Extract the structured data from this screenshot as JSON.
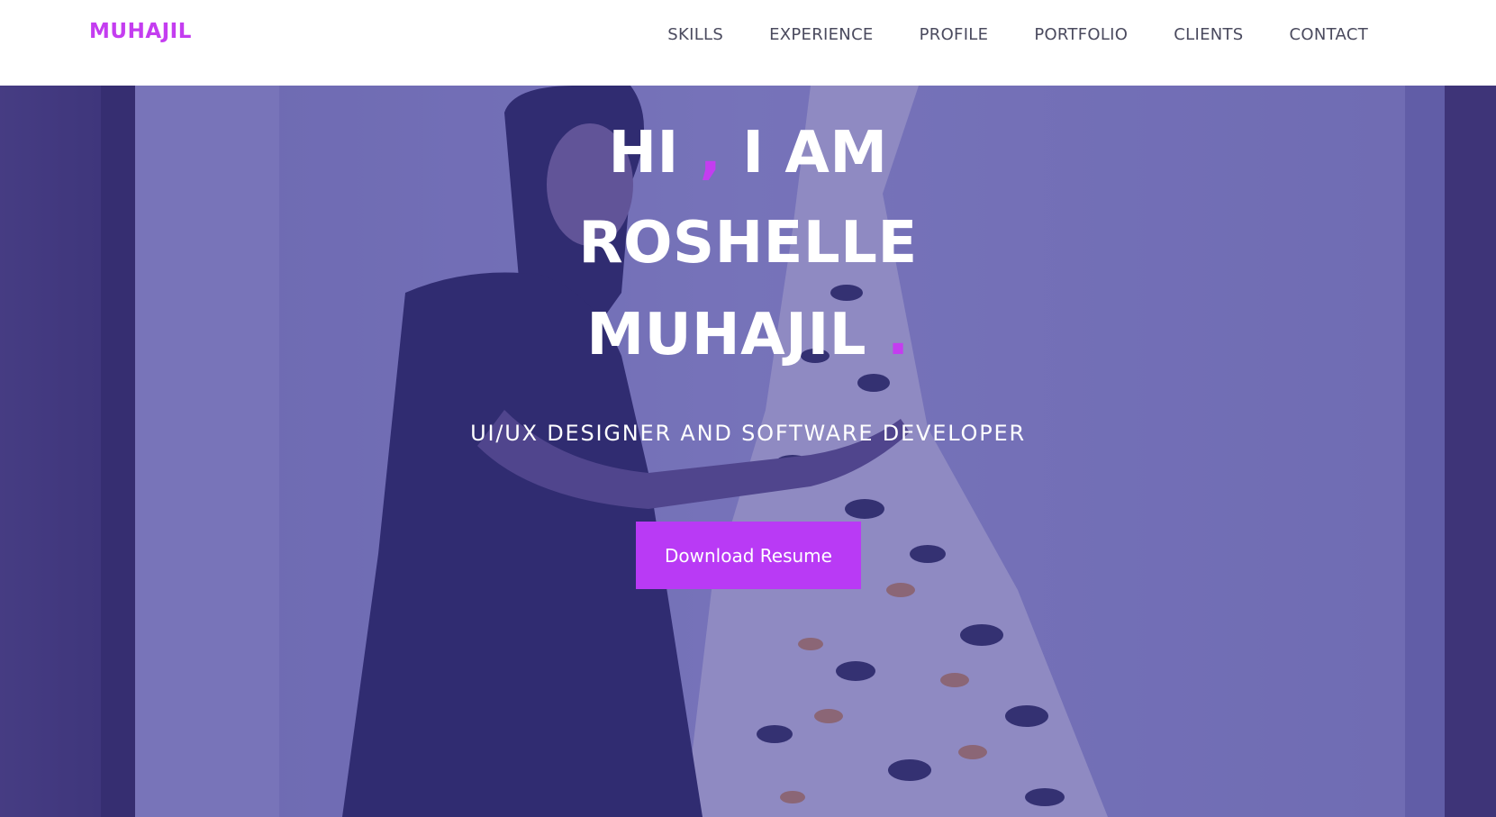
{
  "brand": {
    "name": "MUHAJIL",
    "color": "#c43df0"
  },
  "nav": {
    "items": [
      {
        "label": "SKILLS"
      },
      {
        "label": "EXPERIENCE"
      },
      {
        "label": "PROFILE"
      },
      {
        "label": "PORTFOLIO"
      },
      {
        "label": "CLIENTS"
      },
      {
        "label": "CONTACT"
      }
    ]
  },
  "hero": {
    "line1_part1": "HI ",
    "line1_comma": ",",
    "line1_part2": " I AM",
    "line2": "ROSHELLE",
    "line3": "MUHAJIL ",
    "line3_dot": ".",
    "subtitle": "UI/UX DESIGNER AND SOFTWARE DEVELOPER",
    "cta_label": "Download Resume",
    "background_image": "woman-with-butterfly-dress-photo",
    "accent_color": "#c43df0",
    "button_color": "#b93af5"
  }
}
